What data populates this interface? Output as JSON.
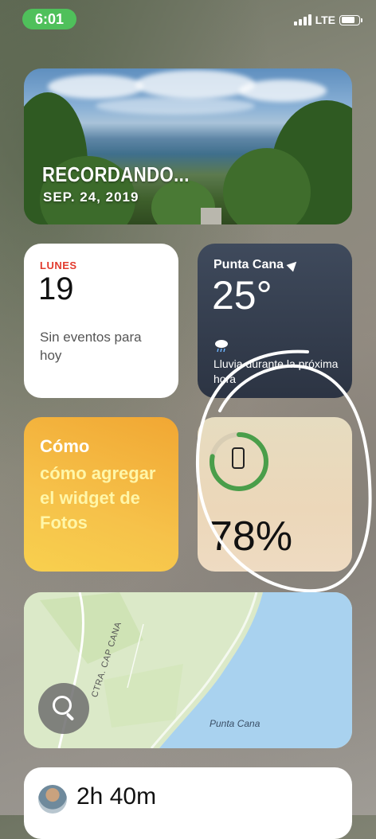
{
  "status_bar": {
    "time": "6:01",
    "network": "LTE",
    "time_bg_color": "#4fc05b"
  },
  "photos_widget": {
    "title": "RECORDANDO...",
    "date": "SEP. 24, 2019"
  },
  "calendar_widget": {
    "day": "LUNES",
    "date": "19",
    "events": "Sin eventos para hoy",
    "accent_color": "#e23b2e"
  },
  "weather_widget": {
    "city": "Punta Cana",
    "temperature": "25°",
    "forecast": "Lluvia durante la próxima hora",
    "icon": "cloud-rain-icon"
  },
  "tips_widget": {
    "title": "Cómo",
    "body": "cómo agregar el widget de Fotos",
    "title_color": "#ffffff",
    "body_color": "#fff6a8"
  },
  "battery_widget": {
    "percent_label": "78%",
    "level": 0.78,
    "ring_color": "#4a9e4a",
    "icon": "iphone-icon"
  },
  "maps_widget": {
    "road_label": "CTRA. CAP CANA",
    "place_label": "Punta Cana",
    "icon": "search-icon"
  },
  "screen_time_widget": {
    "time": "2h 40m"
  }
}
